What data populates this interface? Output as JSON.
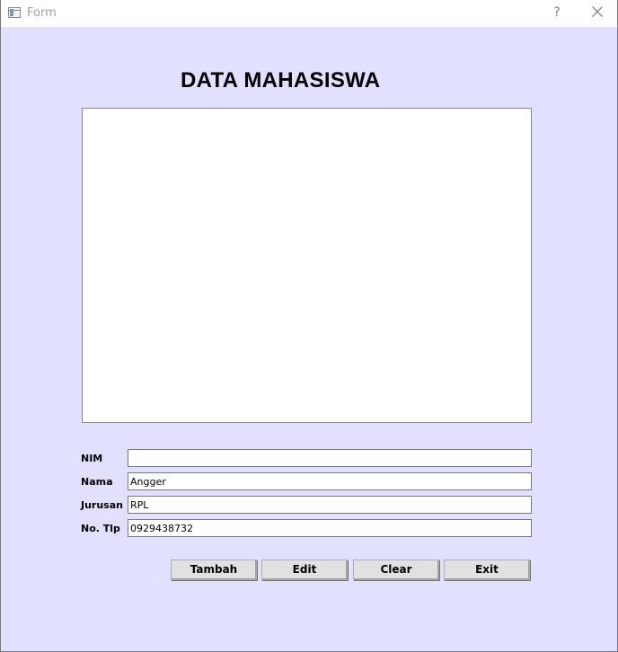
{
  "window": {
    "title": "Form",
    "help_label": "?"
  },
  "form": {
    "heading": "DATA MAHASISWA",
    "fields": [
      {
        "label": "NIM",
        "value": ""
      },
      {
        "label": "Nama",
        "value": "Angger"
      },
      {
        "label": "Jurusan",
        "value": "RPL"
      },
      {
        "label": "No. Tlp",
        "value": "0929438732"
      }
    ],
    "buttons": {
      "tambah": "Tambah",
      "edit": "Edit",
      "clear": "Clear",
      "exit": "Exit"
    }
  },
  "icons": {
    "app": "window-form-icon",
    "help": "question-mark-icon",
    "close": "close-icon"
  },
  "colors": {
    "background": "#e1e1ff",
    "titlebar": "#ffffff",
    "button_face": "#e1e1e1"
  }
}
